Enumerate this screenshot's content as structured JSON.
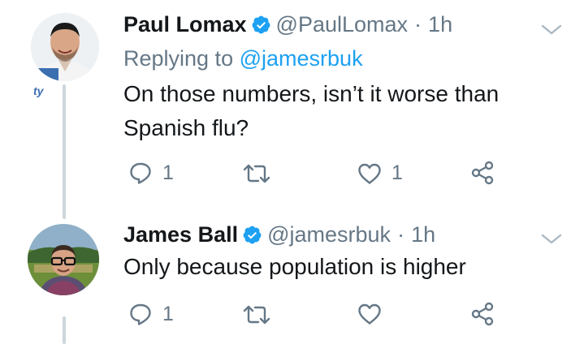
{
  "tweets": [
    {
      "author_name": "Paul Lomax",
      "handle": "@PaulLomax",
      "separator": "·",
      "time": "1h",
      "replying_prefix": "Replying to",
      "replying_to": "@jamesrbuk",
      "text": "On those numbers, isn’t it worse than Spanish flu?",
      "reply_count": "1",
      "retweet_count": "",
      "like_count": "1",
      "avatar_badge_text": "ty"
    },
    {
      "author_name": "James Ball",
      "handle": "@jamesrbuk",
      "separator": "·",
      "time": "1h",
      "text": "Only because population is higher",
      "reply_count": "1",
      "retweet_count": "",
      "like_count": ""
    }
  ],
  "colors": {
    "verified": "#1da1f2",
    "secondary_text": "#657786",
    "mention": "#1da1f2",
    "thread_line": "#ccd6dd"
  },
  "icons": [
    "verified-badge-icon",
    "chevron-down-icon",
    "reply-icon",
    "retweet-icon",
    "like-icon",
    "share-icon"
  ]
}
